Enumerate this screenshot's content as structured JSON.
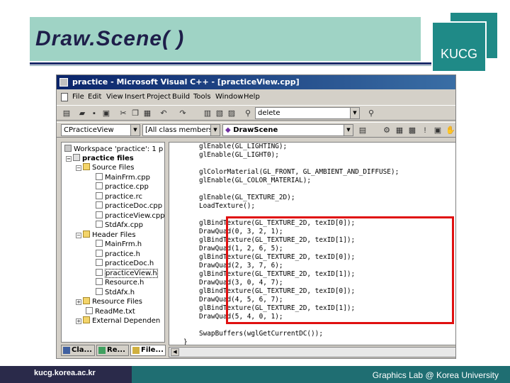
{
  "slide": {
    "title": "Draw.Scene( )",
    "logo": "KUCG",
    "footer_url": "kucg.korea.ac.kr",
    "footer_credit": "Graphics Lab @ Korea University",
    "accent_color": "#1f8a87",
    "title_band_color": "#9fd3c5"
  },
  "window": {
    "title": "practice - Microsoft Visual C++ - [practiceView.cpp]",
    "menu": [
      "File",
      "Edit",
      "View",
      "Insert",
      "Project",
      "Build",
      "Tools",
      "Window",
      "Help"
    ],
    "toolbar": {
      "find_combo": "delete",
      "class_combo": "CPracticeView",
      "filter_combo": "[All class members]",
      "member_combo": "DrawScene"
    }
  },
  "workspace": {
    "items": [
      {
        "label": "Workspace 'practice': 1 p",
        "icon": "workspace-icon"
      },
      {
        "label": "practice files",
        "icon": "project-icon"
      },
      {
        "label": "Source Files",
        "icon": "folder-icon"
      },
      {
        "label": "MainFrm.cpp",
        "icon": "file-icon"
      },
      {
        "label": "practice.cpp",
        "icon": "file-icon"
      },
      {
        "label": "practice.rc",
        "icon": "file-icon"
      },
      {
        "label": "practiceDoc.cpp",
        "icon": "file-icon"
      },
      {
        "label": "practiceView.cpp",
        "icon": "file-icon"
      },
      {
        "label": "StdAfx.cpp",
        "icon": "file-icon"
      },
      {
        "label": "Header Files",
        "icon": "folder-icon"
      },
      {
        "label": "MainFrm.h",
        "icon": "file-icon"
      },
      {
        "label": "practice.h",
        "icon": "file-icon"
      },
      {
        "label": "practiceDoc.h",
        "icon": "file-icon"
      },
      {
        "label": "practiceView.h",
        "icon": "file-icon"
      },
      {
        "label": "Resource.h",
        "icon": "file-icon"
      },
      {
        "label": "StdAfx.h",
        "icon": "file-icon"
      },
      {
        "label": "Resource Files",
        "icon": "folder-icon"
      },
      {
        "label": "ReadMe.txt",
        "icon": "file-icon"
      },
      {
        "label": "External Dependen",
        "icon": "folder-icon"
      }
    ],
    "tabs": [
      "Cla...",
      "Re...",
      "File..."
    ]
  },
  "code": {
    "lines": [
      "glEnable(GL_LIGHTING);",
      "glEnable(GL_LIGHT0);",
      "",
      "glColorMaterial(GL_FRONT, GL_AMBIENT_AND_DIFFUSE);",
      "glEnable(GL_COLOR_MATERIAL);",
      "",
      "glEnable(GL_TEXTURE_2D);",
      "LoadTexture();",
      "",
      "glBindTexture(GL_TEXTURE_2D, texID[0]);",
      "DrawQuad(0, 3, 2, 1);",
      "glBindTexture(GL_TEXTURE_2D, texID[1]);",
      "DrawQuad(1, 2, 6, 5);",
      "glBindTexture(GL_TEXTURE_2D, texID[0]);",
      "DrawQuad(2, 3, 7, 6);",
      "glBindTexture(GL_TEXTURE_2D, texID[1]);",
      "DrawQuad(3, 0, 4, 7);",
      "glBindTexture(GL_TEXTURE_2D, texID[0]);",
      "DrawQuad(4, 5, 6, 7);",
      "glBindTexture(GL_TEXTURE_2D, texID[1]);",
      "DrawQuad(5, 4, 0, 1);",
      "",
      "SwapBuffers(wglGetCurrentDC());",
      "}"
    ]
  }
}
